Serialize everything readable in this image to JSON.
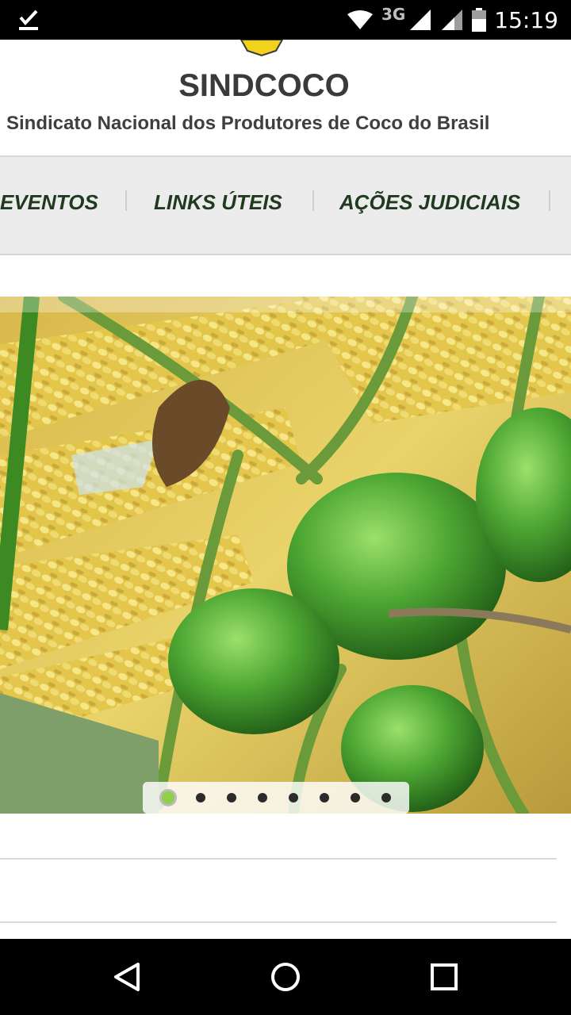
{
  "status_bar": {
    "time": "15:19",
    "network": "3G",
    "icons": [
      "download-done-icon",
      "wifi-icon",
      "signal-icon",
      "signal-icon",
      "battery-icon"
    ]
  },
  "header": {
    "title": "SINDCOCO",
    "subtitle": "Sindicato Nacional dos Produtores de Coco do Brasil"
  },
  "nav": {
    "items": [
      {
        "label": "EVENTOS"
      },
      {
        "label": "LINKS ÚTEIS"
      },
      {
        "label": "AÇÕES JUDICIAIS"
      }
    ]
  },
  "slider": {
    "image": "coconut-bunch-photo",
    "dot_count": 8,
    "active_dot": 1
  },
  "android_nav": {
    "buttons": [
      "back-icon",
      "home-icon",
      "recents-icon"
    ]
  },
  "colors": {
    "nav_text": "#1f3a1f",
    "nav_bg": "#ececec",
    "active_dot": "#8ed04a"
  }
}
